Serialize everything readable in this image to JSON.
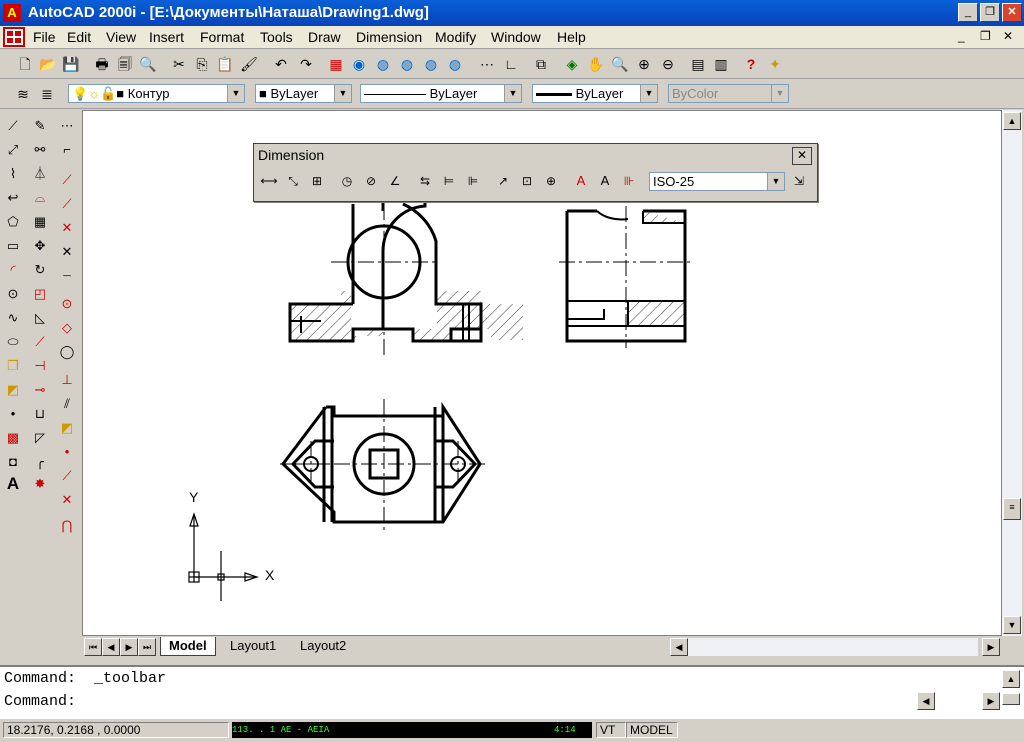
{
  "window": {
    "title": "AutoCAD 2000i - [E:\\Документы\\Наташа\\Drawing1.dwg]",
    "logo_glyph": "A"
  },
  "menubar": {
    "items": [
      {
        "label": "File"
      },
      {
        "label": "Edit"
      },
      {
        "label": "View"
      },
      {
        "label": "Insert"
      },
      {
        "label": "Format"
      },
      {
        "label": "Tools"
      },
      {
        "label": "Draw"
      },
      {
        "label": "Dimension"
      },
      {
        "label": "Modify"
      },
      {
        "label": "Window"
      },
      {
        "label": "Help"
      }
    ]
  },
  "properties": {
    "layer": "Контур",
    "color": "ByLayer",
    "linetype": "ByLayer",
    "lineweight": "ByLayer",
    "plotstyle": "ByColor"
  },
  "dimension_toolbar": {
    "title": "Dimension",
    "style": "ISO-25"
  },
  "drawing": {
    "ucs_x": "X",
    "ucs_y": "Y"
  },
  "layout_tabs": [
    {
      "label": "Model",
      "active": true
    },
    {
      "label": "Layout1",
      "active": false
    },
    {
      "label": "Layout2",
      "active": false
    }
  ],
  "command": {
    "line1": "Command:  _toolbar",
    "line2": "Command:"
  },
  "status": {
    "coords": "18.2176, 0.2168 , 0.0000",
    "strip": "113.  . 1 AE -  AEIA",
    "time": "4:14",
    "otrack": "VT",
    "model": "MODEL"
  }
}
